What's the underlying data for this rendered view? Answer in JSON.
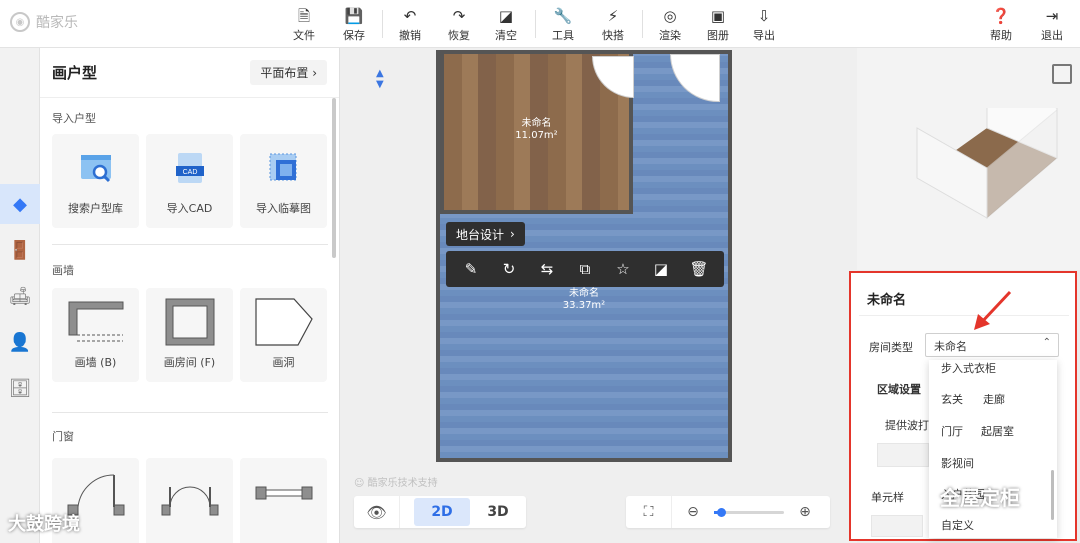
{
  "app": {
    "logo_text": "酷家乐"
  },
  "toolbar": {
    "file": "文件",
    "save": "保存",
    "undo": "撤销",
    "redo": "恢复",
    "clear": "清空",
    "tools": "工具",
    "quick": "快搭",
    "render": "渲染",
    "album": "图册",
    "export": "导出",
    "help": "帮助",
    "exit": "退出"
  },
  "panel": {
    "title": "画户型",
    "layout_link": "平面布置",
    "import_section": "导入户型",
    "import_items": [
      "搜索户型库",
      "导入CAD",
      "导入临摹图"
    ],
    "cad_badge": "CAD",
    "wall_section": "画墙",
    "wall_items": [
      "画墙 (B)",
      "画房间 (F)",
      "画洞"
    ],
    "door_section": "门窗"
  },
  "canvas": {
    "room_top_name": "未命名",
    "room_top_area": "11.07m²",
    "room_big_name": "未命名",
    "room_big_area": "33.37m²",
    "bubble_label": "地台设计",
    "watermark": "酷家乐技术支持",
    "view_2d": "2D",
    "view_3d": "3D",
    "zoom_level": 0.1
  },
  "properties": {
    "title": "未命名",
    "room_type_label": "房间类型",
    "room_type_value": "未命名",
    "area_settings": "区域设置",
    "provide": "提供波打",
    "unit": "单元样",
    "dropdown_options": [
      "步入式衣柜",
      "玄关",
      "走廊",
      "门厅",
      "起居室",
      "影视间",
      "入户花园",
      "自定义"
    ]
  },
  "overlays": {
    "brand_wm": "全屋定柜",
    "bottom_wm": "大鼓跨境"
  },
  "colors": {
    "accent": "#3478f6",
    "highlight_box": "#e4352b",
    "toolbar_bg": "#2f2f2f"
  }
}
